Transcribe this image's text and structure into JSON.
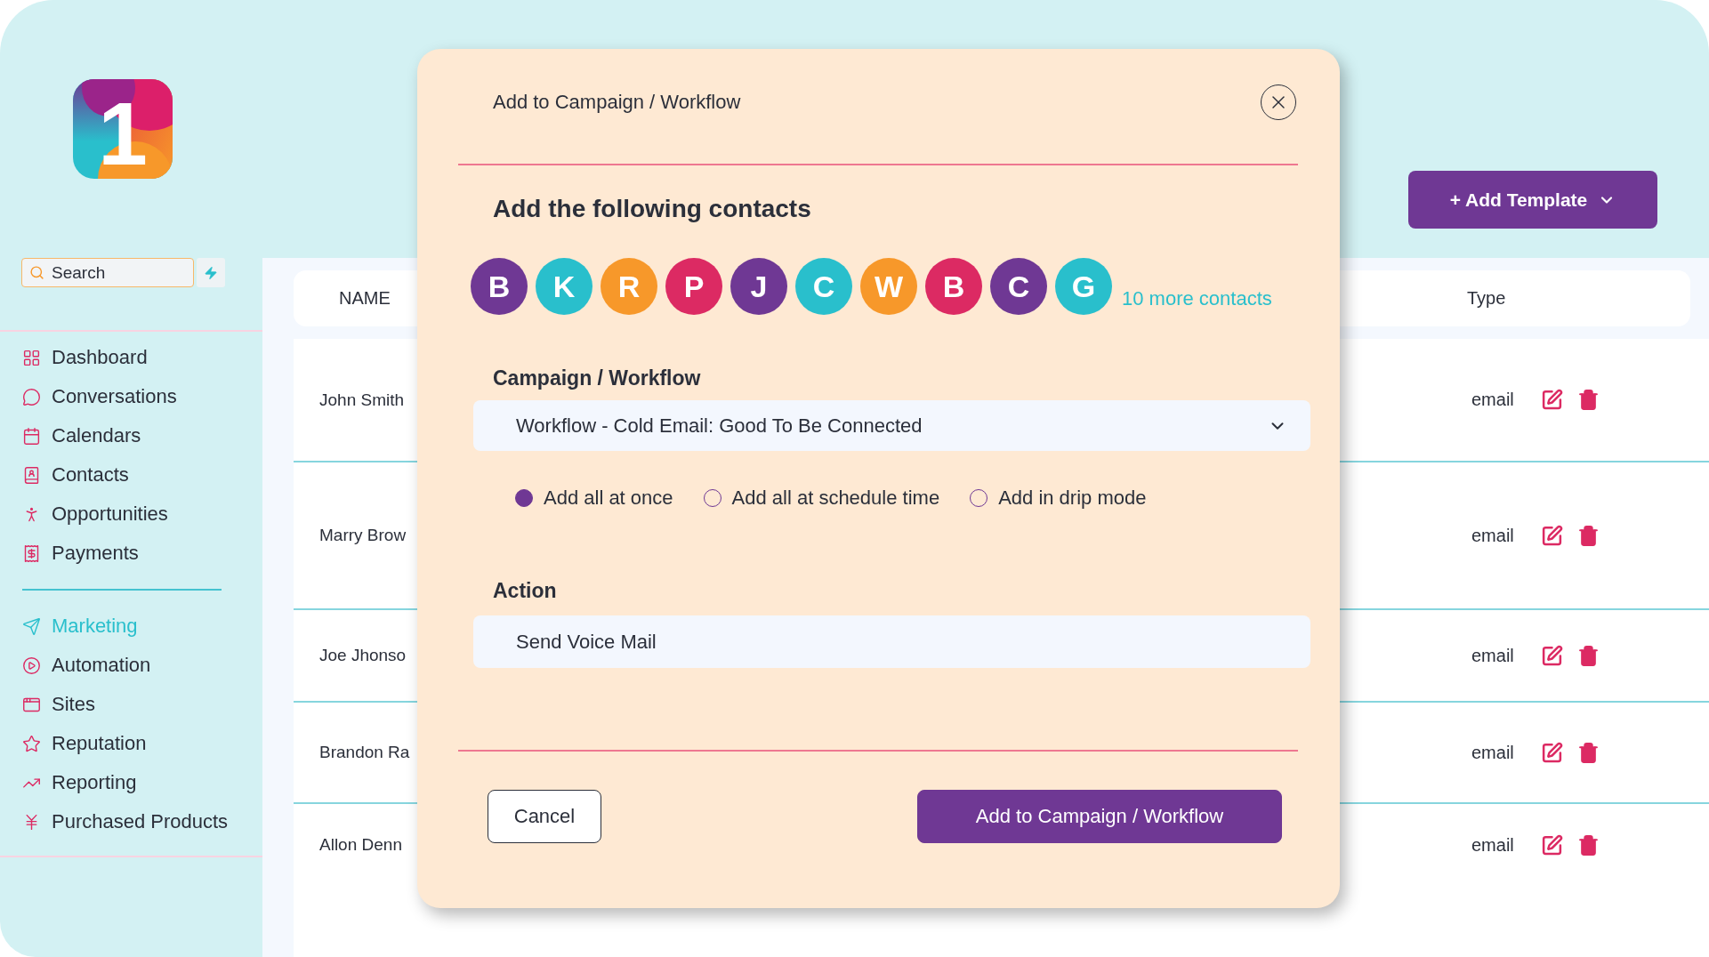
{
  "logo": {
    "mark": "1"
  },
  "sidebar": {
    "search": {
      "placeholder": "Search"
    },
    "main_items": [
      {
        "label": "Dashboard",
        "selected": false
      },
      {
        "label": "Conversations",
        "selected": false
      },
      {
        "label": "Calendars",
        "selected": false
      },
      {
        "label": "Contacts",
        "selected": false
      },
      {
        "label": "Opportunities",
        "selected": false
      },
      {
        "label": "Payments",
        "selected": false
      }
    ],
    "tool_items": [
      {
        "label": "Marketing",
        "selected": true
      },
      {
        "label": "Automation",
        "selected": false
      },
      {
        "label": "Sites",
        "selected": false
      },
      {
        "label": "Reputation",
        "selected": false
      },
      {
        "label": "Reporting",
        "selected": false
      },
      {
        "label": "Purchased Products",
        "selected": false
      }
    ]
  },
  "toolbar": {
    "add_template_button": "+ Add Template"
  },
  "table": {
    "columns": [
      "NAME",
      "Type"
    ],
    "rows": [
      {
        "name": "John Smith",
        "type": "email"
      },
      {
        "name": "Marry Brow",
        "type": "email"
      },
      {
        "name": "Joe Jhonso",
        "type": "email"
      },
      {
        "name": "Brandon Ra",
        "type": "email"
      },
      {
        "name": "Allon Denn",
        "type": "email"
      }
    ]
  },
  "modal": {
    "title": "Add to Campaign / Workflow",
    "heading": "Add the following contacts",
    "contacts": [
      {
        "initial": "B",
        "color": "#6f3894"
      },
      {
        "initial": "K",
        "color": "#29bfcc"
      },
      {
        "initial": "R",
        "color": "#f7982a"
      },
      {
        "initial": "P",
        "color": "#dc2a63"
      },
      {
        "initial": "J",
        "color": "#6f3894"
      },
      {
        "initial": "C",
        "color": "#29bfcc"
      },
      {
        "initial": "W",
        "color": "#f7982a"
      },
      {
        "initial": "B",
        "color": "#dc2a63"
      },
      {
        "initial": "C",
        "color": "#6f3894"
      },
      {
        "initial": "G",
        "color": "#29bfcc"
      }
    ],
    "more_contacts": "10 more contacts",
    "campaign_field": {
      "label": "Campaign / Workflow",
      "value": "Workflow - Cold Email: Good To Be Connected"
    },
    "add_modes": [
      {
        "label": "Add all at once",
        "selected": true
      },
      {
        "label": "Add all at schedule time",
        "selected": false
      },
      {
        "label": "Add in drip mode",
        "selected": false
      }
    ],
    "action_field": {
      "label": "Action",
      "value": "Send Voice Mail"
    },
    "buttons": [
      {
        "label": "Cancel",
        "kind": "secondary"
      },
      {
        "label": "Add to Campaign / Workflow",
        "kind": "primary"
      }
    ]
  }
}
